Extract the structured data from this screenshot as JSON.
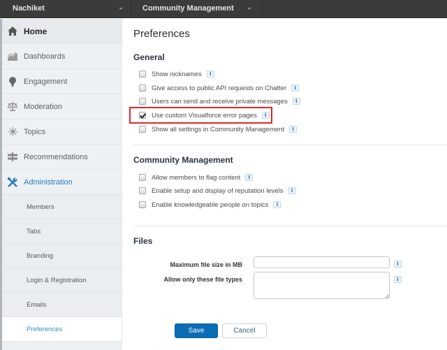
{
  "topbar": {
    "user_selector": "Nachiket",
    "workspace_selector": "Community Management"
  },
  "sidebar": {
    "items": [
      {
        "label": "Home",
        "icon": "home-icon"
      },
      {
        "label": "Dashboards",
        "icon": "chart-icon"
      },
      {
        "label": "Engagement",
        "icon": "lightbulb-icon"
      },
      {
        "label": "Moderation",
        "icon": "scales-icon"
      },
      {
        "label": "Topics",
        "icon": "topics-icon"
      },
      {
        "label": "Recommendations",
        "icon": "signpost-icon"
      },
      {
        "label": "Administration",
        "icon": "tools-icon"
      }
    ],
    "sub_items": [
      {
        "label": "Members"
      },
      {
        "label": "Tabs"
      },
      {
        "label": "Branding"
      },
      {
        "label": "Login & Registration"
      },
      {
        "label": "Emails"
      },
      {
        "label": "Preferences",
        "active": true
      }
    ]
  },
  "main": {
    "title": "Preferences",
    "general": {
      "title": "General",
      "options": [
        {
          "label": "Show nicknames",
          "checked": false
        },
        {
          "label": "Give access to public API requests on Chatter",
          "checked": false
        },
        {
          "label": "Users can send and receive private messages",
          "checked": false
        },
        {
          "label": "Use custom Visualforce error pages",
          "checked": true,
          "highlighted": true
        },
        {
          "label": "Show all settings in Community Management",
          "checked": false
        }
      ]
    },
    "community_management": {
      "title": "Community Management",
      "options": [
        {
          "label": "Allow members to flag content",
          "checked": false
        },
        {
          "label": "Enable setup and display of reputation levels",
          "checked": false
        },
        {
          "label": "Enable knowledgeable people on topics",
          "checked": false
        }
      ]
    },
    "files": {
      "title": "Files",
      "max_size_label": "Maximum file size in MB",
      "max_size_value": "",
      "file_types_label": "Allow only these file types",
      "file_types_value": ""
    },
    "info_glyph": "i",
    "save_label": "Save",
    "cancel_label": "Cancel"
  },
  "colors": {
    "accent": "#0b6db3",
    "highlight_border": "#e0262b",
    "active_nav": "#2e8ec6"
  }
}
